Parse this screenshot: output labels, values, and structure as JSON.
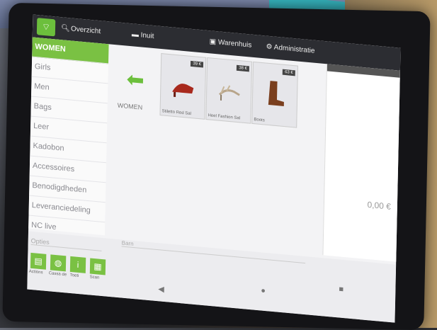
{
  "topbar": {
    "overview_label": "Overzicht",
    "inuit_label": "Inuit",
    "warenhuis_label": "Warenhuis",
    "administratie_label": "Administratie"
  },
  "sidebar": {
    "items": [
      {
        "label": "WOMEN"
      },
      {
        "label": "Girls"
      },
      {
        "label": "Men"
      },
      {
        "label": "Bags"
      },
      {
        "label": "Leer"
      },
      {
        "label": "Kadobon"
      },
      {
        "label": "Accessoires"
      },
      {
        "label": "Benodigdheden"
      },
      {
        "label": "Leveranciedeling"
      },
      {
        "label": "NC live"
      }
    ]
  },
  "main": {
    "category_label": "WOMEN",
    "products": [
      {
        "price": "39 €",
        "name": "Stiletto Red Sal"
      },
      {
        "price": "38 €",
        "name": "Heel Fashion Sal"
      },
      {
        "price": "63 €",
        "name": "Boots"
      }
    ]
  },
  "panel": {
    "total": "0,00 €"
  },
  "bottom": {
    "search_placeholder": "Opties",
    "search2_placeholder": "Barn",
    "buttons": [
      {
        "label": "Actions"
      },
      {
        "label": "Cassa de"
      },
      {
        "label": "Toeti"
      },
      {
        "label": "Scan"
      }
    ]
  },
  "colors": {
    "accent": "#7ac143",
    "topbar": "#2c2d32"
  }
}
